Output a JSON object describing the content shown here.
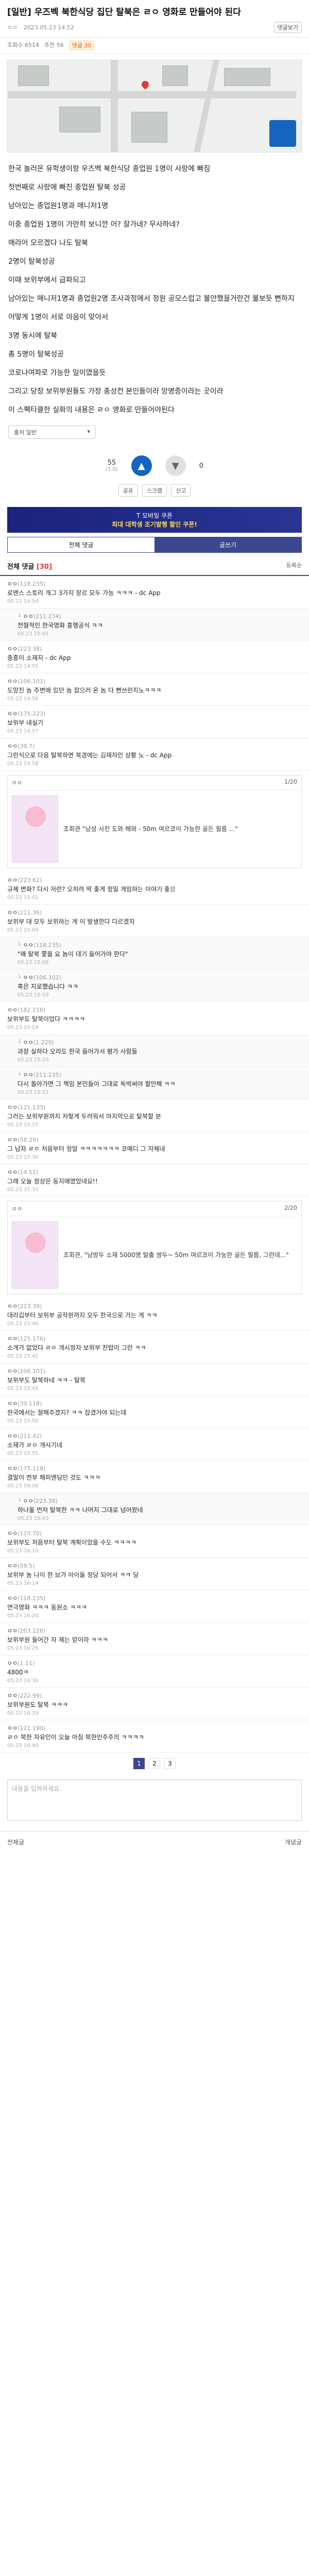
{
  "post": {
    "title": "[일반] 우즈벡 북한식당 집단 탈북은 ㄹㅇ 영화로 만들어야 된다",
    "author": "ㅇㅇ",
    "date": "2023.05.23 14:52",
    "report_label": "댓글보기",
    "views": "조회수 6514",
    "recommend": "추천 56",
    "comment_badge": "댓글 30"
  },
  "article": [
    "한국 놀러온 유학생이랑 우즈벡 북한식당 종업원 1명이 사랑에 빠짐",
    "첫번째로 사랑에 빠진 종업원 탈북 성공",
    "남아있는 종업원1명과 매니저1명",
    "이중 종업원 1명이 가만히 보니깐 어? 잘가네? 무사하네?",
    "매라어 모르겠다 나도 탈북",
    "2명이 탈북성공",
    "이때 보위부에서 급파되고",
    "남아있는 매니저1명과 종업원2명 조사과정에서 정원 공모스럽고 불안했을거란건 불보듯 뻔하지",
    "어떻게 1명이 서로 마음이 맞아서",
    "3명 동시에 탈북",
    "총 5명이 탈북성공",
    "코로나여파로 가능한 일이였을듯",
    "그리고 당장 보위부원들도 가장 충성컨 본인들이라 망명증이라는 곳이라",
    "이 스펙타클한 실화의 내용은 ㄹㅇ 영화로 만들어야된다"
  ],
  "source": {
    "label": "출처 일반",
    "value": ""
  },
  "votes": {
    "up": "55",
    "up_sub": "(1.0)",
    "down": "0"
  },
  "share": [
    "공유",
    "스크랩",
    "신고"
  ],
  "ad": {
    "line1": "T 모바일 쿠폰",
    "line2": "최대 대학생 조기발행 할인 쿠폰!"
  },
  "tabs": [
    "전체 댓글",
    "글쓰기"
  ],
  "comments_header": {
    "label": "전체 댓글",
    "count": "[30]",
    "sort": "등록순"
  },
  "comments": [
    {
      "nick": "ㅇㅇ",
      "ip": "(118.235)",
      "text": "로맨스 스토리 개그 3가지 장르 모두 가능 ㅋㅋㅋ - dc App",
      "date": "05.23 14:54",
      "reply": false
    },
    {
      "nick": "ㅇㅇ",
      "ip": "(211.234)",
      "text": "전형적인 한국영화 흥행공식 ㅋㅋ",
      "date": "05.23 15:01",
      "reply": true
    },
    {
      "nick": "ㅇㅇ",
      "ip": "(223.38)",
      "text": "중흥이 소재지 - dc App",
      "date": "05.23 14:55",
      "reply": false
    },
    {
      "nick": "ㅇㅇ",
      "ip": "(106.101)",
      "text": "도망친 놈 주변에 있던 놈 잡으러 온 놈 다 뻔쓰런지노ㅋㅋㅋ",
      "date": "05.23 14:56",
      "reply": false
    },
    {
      "nick": "ㅇㅇ",
      "ip": "(175.223)",
      "text": "보위부 내실기",
      "date": "05.23 14:57",
      "reply": false
    },
    {
      "nick": "ㅇㅇ",
      "ip": "(39.7)",
      "text": "그런식으로 다음 탈북하면 북경에는 김재자인 상황 노 - dc App",
      "date": "05.23 14:58",
      "reply": false
    },
    {
      "nick": "ㅇㅇ",
      "ip": "(223.62)",
      "text": "규제 변화? 다시 저런? 오히려 딱 좋게 정밀 게임하는 이야기 좋으",
      "date": "05.23 15:02",
      "reply": false
    },
    {
      "nick": "ㅇㅇ",
      "ip": "(211.36)",
      "text": "보위부 대 모두 보위하는 게 이 발생한다 다르겠지",
      "date": "05.23 15:04",
      "reply": false
    },
    {
      "nick": "ㅇㅇ",
      "ip": "(118.235)",
      "text": "\"왜 탈북 쫓을 요 놈이 대기 들어가야 한다\"",
      "date": "05.23 15:06",
      "reply": true
    },
    {
      "nick": "ㅇㅇ",
      "ip": "(106.102)",
      "text": "혹은 지로했습니다 ㅋㅋ",
      "date": "05.23 15:10",
      "reply": true
    },
    {
      "nick": "ㅇㅇ",
      "ip": "(182.216)",
      "text": "보위부도 탈북이었다 ㅋㅋㅋㅋ",
      "date": "05.23 15:14",
      "reply": false
    },
    {
      "nick": "ㅇㅇ",
      "ip": "(1.220)",
      "text": "과장 실하다 오라도 한국 들어가서 평가 사람들",
      "date": "05.23 15:20",
      "reply": true
    },
    {
      "nick": "ㅇㅇ",
      "ip": "(211.235)",
      "text": "다시 돌아가면 그 책임 본인들이 그대로 독박써야 할만해 ㅋㅋ",
      "date": "05.23 15:22",
      "reply": true
    },
    {
      "nick": "ㅇㅇ",
      "ip": "(121.133)",
      "text": "그러는 보위부원까지 저렇게 두려워서 마지막으로 탈북할 분",
      "date": "05.23 15:25",
      "reply": false
    },
    {
      "nick": "ㅇㅇ",
      "ip": "(58.29)",
      "text": "그 남자 ㄹㅇ 처음부터 정말 ㅋㅋㅋㅋㅋㅋㅋ 코메디 그 자체네",
      "date": "05.23 15:30",
      "reply": false
    },
    {
      "nick": "ㅇㅇ",
      "ip": "(14.52)",
      "text": "그래 오늘 정상은 동지애였었네요!!",
      "date": "05.23 15:33",
      "reply": false
    },
    {
      "nick": "ㅇㅇ",
      "ip": "(223.39)",
      "text": "대리깁부터 보위부 공작원까지 모두 한국으로 가는 게 ㅋㅋ",
      "date": "05.23 15:40",
      "reply": false
    },
    {
      "nick": "ㅇㅇ",
      "ip": "(125.176)",
      "text": "소개가 없었다 ㄹㅇ 개시정자 보위부 찬밥이 그런 ㅋㅋ",
      "date": "05.23 15:42",
      "reply": false
    },
    {
      "nick": "ㅇㅇ",
      "ip": "(106.101)",
      "text": "보위부도 탈북하네 ㅋㅋ - 탈북",
      "date": "05.23 15:45",
      "reply": false
    },
    {
      "nick": "ㅇㅇ",
      "ip": "(39.118)",
      "text": "한국에서는 잘해주겠지? ㅋㅋ 잡겼거야 되는데",
      "date": "05.23 15:50",
      "reply": false
    },
    {
      "nick": "ㅇㅇ",
      "ip": "(211.42)",
      "text": "소재가 ㄹㅇ 개사기네",
      "date": "05.23 15:55",
      "reply": false
    },
    {
      "nick": "ㅇㅇ",
      "ip": "(175.118)",
      "text": "결말이 전부 해피엔딩인 것도 ㅋㅋㅋ",
      "date": "05.23 16:00",
      "reply": false
    },
    {
      "nick": "ㅇㅇ",
      "ip": "(223.38)",
      "text": "하나둘 먼저 탈북한 ㅋㅋ 나머지 그대로 넘어왔네",
      "date": "05.23 16:03",
      "reply": true
    },
    {
      "nick": "ㅇㅇ",
      "ip": "(110.70)",
      "text": "보위부도 처음부터 탈북 계획이었을 수도 ㅋㅋㅋㅋ",
      "date": "05.23 16:10",
      "reply": false
    },
    {
      "nick": "ㅇㅇ",
      "ip": "(59.5)",
      "text": "보위부 놈 나이 한 보가 아이들 정당 되어서 ㅋㅋ 딩",
      "date": "05.23 16:14",
      "reply": false
    },
    {
      "nick": "ㅇㅇ",
      "ip": "(118.235)",
      "text": "연극영화 ㅋㅋㅋ 동원소 ㅋㅋㅋ",
      "date": "05.23 16:20",
      "reply": false
    },
    {
      "nick": "ㅇㅇ",
      "ip": "(203.226)",
      "text": "보위부원 들어간 자 제는 맏이라 ㅋㅋㅋ",
      "date": "05.23 16:25",
      "reply": false
    },
    {
      "nick": "ㅇㅇ",
      "ip": "(1.11)",
      "text": "4800ㅋ",
      "date": "05.23 16:30",
      "reply": false
    },
    {
      "nick": "ㅇㅇ",
      "ip": "(222.99)",
      "text": "보위부원도 탈북 ㅋㅋㅋ",
      "date": "05.23 16:33",
      "reply": false
    },
    {
      "nick": "ㅇㅇ",
      "ip": "(121.190)",
      "text": "ㄹㅇ 북한 자유인이 오늘 아침 북한민주주의 ㅋㅋㅋㅋ",
      "date": "05.23 16:40",
      "reply": false
    }
  ],
  "img_cards": [
    {
      "name": "ㅇㅇ",
      "page": "1/20",
      "caption": "조회관 \"남성 사진 도와 해와 - 50m 여르코이 가능한 골든 필름 ...\""
    },
    {
      "name": "ㅇㅇ",
      "page": "2/20",
      "caption": "조회관, \"남방두 소재 5000명 탈출 쌍두~ 50m 여르코이 가능한 골든 필름, 그런데...\""
    }
  ],
  "pager": [
    "1",
    "2",
    "3"
  ],
  "bottom": {
    "left": "전체글",
    "right": "개념글"
  },
  "input_placeholder": "내용을 입력하세요."
}
